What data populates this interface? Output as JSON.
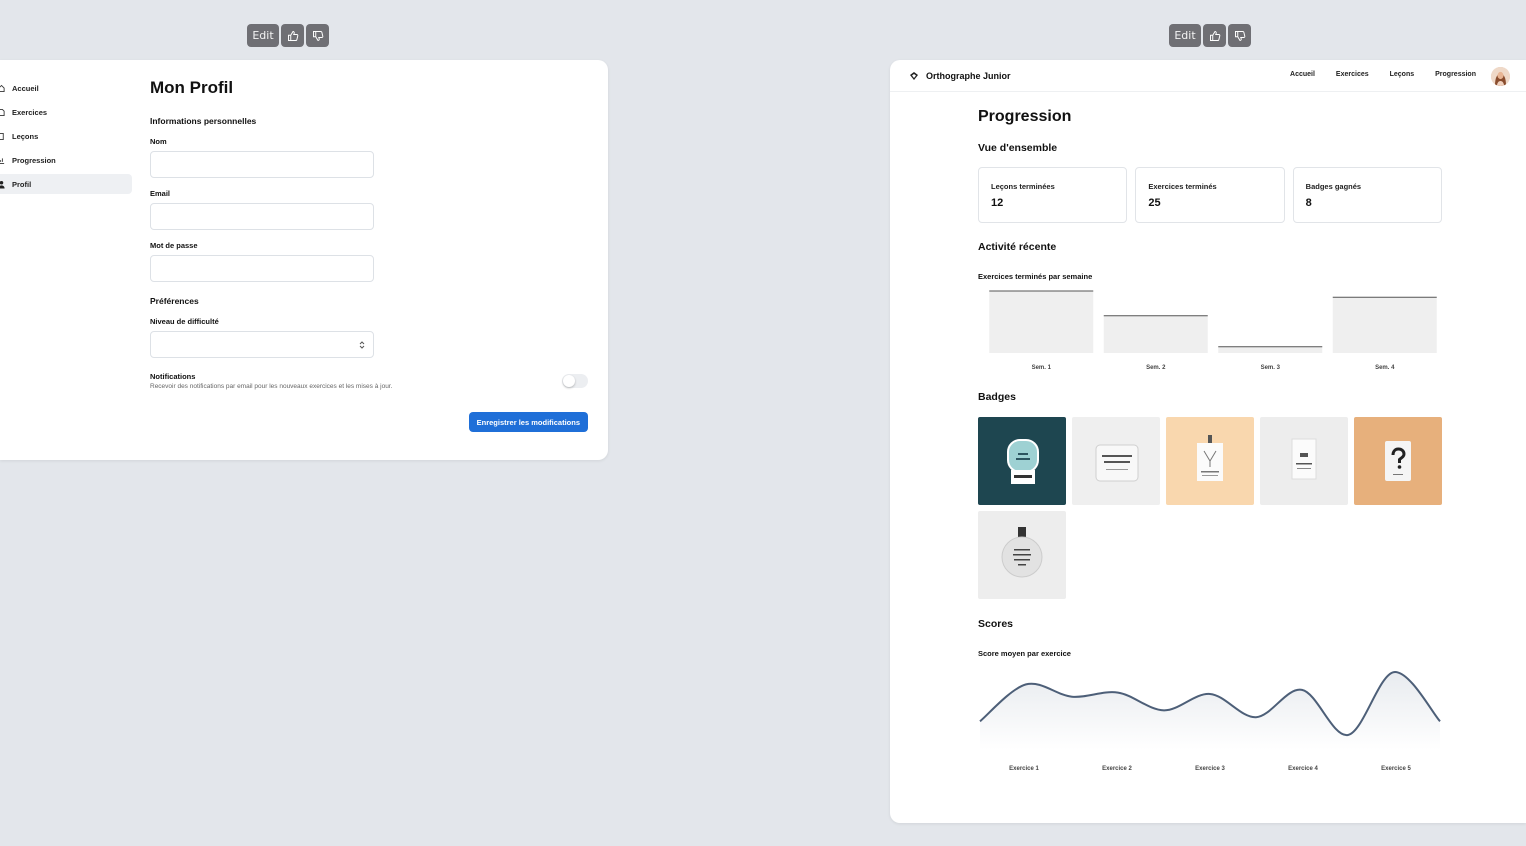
{
  "toolbar_left": {
    "edit": "Edit"
  },
  "toolbar_right": {
    "edit": "Edit"
  },
  "profile": {
    "sidebar": [
      {
        "label": "Accueil",
        "icon": "home-icon"
      },
      {
        "label": "Exercices",
        "icon": "file-icon"
      },
      {
        "label": "Leçons",
        "icon": "book-icon"
      },
      {
        "label": "Progression",
        "icon": "chart-icon"
      },
      {
        "label": "Profil",
        "icon": "user-icon",
        "active": true
      }
    ],
    "title": "Mon Profil",
    "section_personal": "Informations personnelles",
    "name_label": "Nom",
    "name_value": "",
    "email_label": "Email",
    "email_value": "",
    "password_label": "Mot de passe",
    "password_value": "",
    "section_prefs": "Préférences",
    "difficulty_label": "Niveau de difficulté",
    "difficulty_value": "",
    "notifications_label": "Notifications",
    "notifications_desc": "Recevoir des notifications par email pour les nouveaux exercices et les mises à jour.",
    "notifications_enabled": false,
    "save_button": "Enregistrer les modifications",
    "accent": "#1f6fd8"
  },
  "progress": {
    "brand": "Orthographe Junior",
    "nav": [
      "Accueil",
      "Exercices",
      "Leçons",
      "Progression"
    ],
    "title": "Progression",
    "overview_title": "Vue d'ensemble",
    "cards": [
      {
        "label": "Leçons terminées",
        "value": "12"
      },
      {
        "label": "Exercices terminés",
        "value": "25"
      },
      {
        "label": "Badges gagnés",
        "value": "8"
      }
    ],
    "activity_title": "Activité récente",
    "badges_title": "Badges",
    "badges": [
      {
        "bg": "#1e4650",
        "kind": "tag-dark"
      },
      {
        "bg": "#efefef",
        "kind": "card-text"
      },
      {
        "bg": "#f9d7ae",
        "kind": "tag-light"
      },
      {
        "bg": "#ededed",
        "kind": "tag-light"
      },
      {
        "bg": "#e7b07c",
        "kind": "tag-question"
      },
      {
        "bg": "#ededed",
        "kind": "round-tag"
      }
    ],
    "scores_title": "Scores"
  },
  "chart_data": [
    {
      "type": "bar",
      "title": "Exercices terminés par semaine",
      "categories": [
        "Sem. 1",
        "Sem. 2",
        "Sem. 3",
        "Sem. 4"
      ],
      "values": [
        10,
        6,
        1,
        9
      ],
      "ylim": [
        0,
        10
      ]
    },
    {
      "type": "area",
      "title": "Score moyen par exercice",
      "categories": [
        "Exercice 1",
        "Exercice 2",
        "Exercice 3",
        "Exercice 4",
        "Exercice 5"
      ],
      "x": [
        0,
        0.4,
        0.8,
        1.2,
        1.6,
        2.0,
        2.4,
        2.8,
        3.2,
        3.6,
        4.0
      ],
      "values": [
        61,
        88,
        79,
        82,
        69,
        81,
        64,
        84,
        51,
        97,
        61
      ],
      "ylim": [
        40,
        100
      ]
    }
  ]
}
